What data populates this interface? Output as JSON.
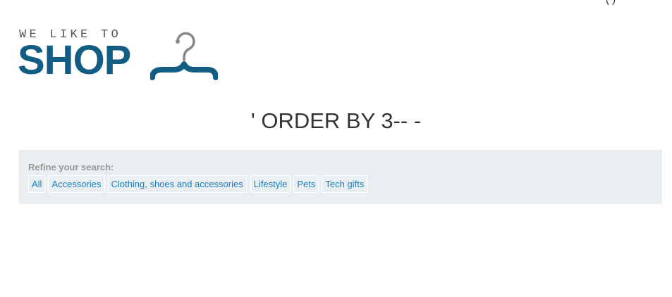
{
  "header": {
    "top_fragment": "( )",
    "logo_small": "WE LIKE TO",
    "logo_big": "SHOP"
  },
  "main": {
    "heading": "' ORDER BY 3-- -"
  },
  "filters": {
    "label": "Refine your search:",
    "categories": [
      "All",
      "Accessories",
      "Clothing, shoes and accessories",
      "Lifestyle",
      "Pets",
      "Tech gifts"
    ]
  },
  "colors": {
    "brand": "#135d85",
    "link": "#1b7fbf",
    "panel": "#e9eef0",
    "hanger_hook": "#888888"
  },
  "icons": {
    "logo": "hanger-icon"
  }
}
